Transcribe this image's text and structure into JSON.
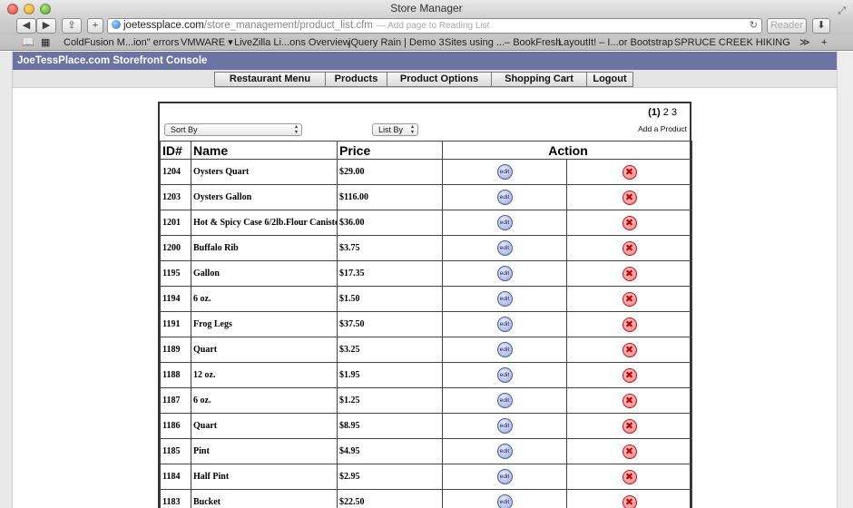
{
  "window": {
    "title": "Store Manager"
  },
  "toolbar": {
    "back": "◀",
    "forward": "▶",
    "share": "⇪",
    "new_tab": "+",
    "url_domain": "joetessplace.com",
    "url_path": "/store_management/product_list.cfm",
    "url_hint": "— Add page to Reading List",
    "reader": "Reader"
  },
  "bookmarks": [
    "ColdFusion M...ion\" errors",
    "VMWARE ▾",
    "LiveZilla Li...ons Overview",
    "jQuery Rain | Demo 3",
    "Sites using ...– BookFresh",
    "LayoutIt! – I...or Bootstrap",
    "SPRUCE CREEK HIKING"
  ],
  "site": {
    "title": "JoeTessPlace.com Storefront Console"
  },
  "nav": [
    "Restaurant Menu",
    "Products",
    "Product Options",
    "Shopping Cart",
    "Logout"
  ],
  "pager": {
    "current": "(1)",
    "pages": [
      "2",
      "3"
    ]
  },
  "controls": {
    "sort_by": "Sort By",
    "list_by": "List By",
    "add_product": "Add a Product"
  },
  "table": {
    "headers": {
      "id": "ID#",
      "name": "Name",
      "price": "Price",
      "action": "Action"
    },
    "edit_label": "edit",
    "delete_glyph": "✖",
    "rows": [
      {
        "id": "1204",
        "name": "Oysters Quart",
        "price": "$29.00"
      },
      {
        "id": "1203",
        "name": "Oysters Gallon",
        "price": "$116.00"
      },
      {
        "id": "1201",
        "name": "Hot & Spicy Case 6/2lb.Flour Canisters",
        "price": "$36.00"
      },
      {
        "id": "1200",
        "name": "Buffalo Rib",
        "price": "$3.75"
      },
      {
        "id": "1195",
        "name": "Gallon",
        "price": "$17.35"
      },
      {
        "id": "1194",
        "name": "6 oz.",
        "price": "$1.50"
      },
      {
        "id": "1191",
        "name": "Frog Legs",
        "price": "$37.50"
      },
      {
        "id": "1189",
        "name": "Quart",
        "price": "$3.25"
      },
      {
        "id": "1188",
        "name": "12 oz.",
        "price": "$1.95"
      },
      {
        "id": "1187",
        "name": "6 oz.",
        "price": "$1.25"
      },
      {
        "id": "1186",
        "name": "Quart",
        "price": "$8.95"
      },
      {
        "id": "1185",
        "name": "Pint",
        "price": "$4.95"
      },
      {
        "id": "1184",
        "name": "Half Pint",
        "price": "$2.95"
      },
      {
        "id": "1183",
        "name": "Bucket",
        "price": "$22.50"
      }
    ]
  }
}
